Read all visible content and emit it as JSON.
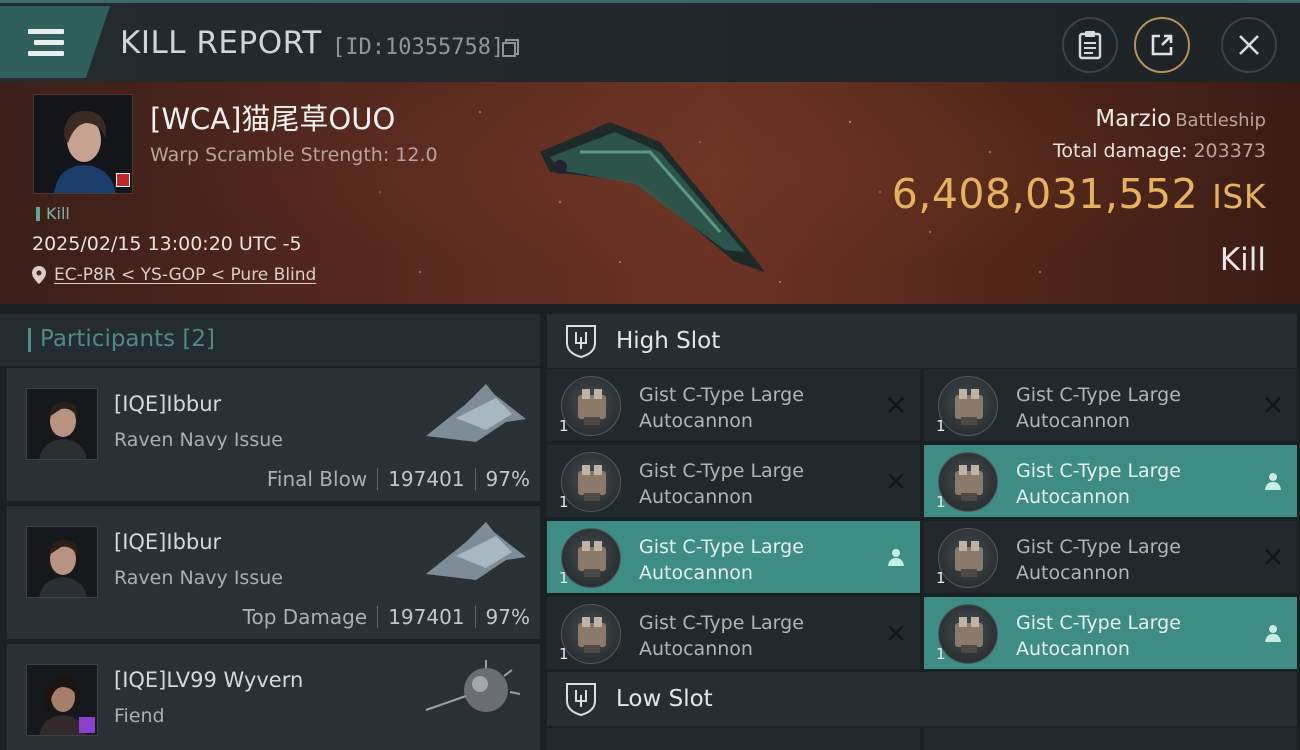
{
  "header": {
    "title": "KILL REPORT",
    "report_id": "[ID:10355758]"
  },
  "victim": {
    "name": "[WCA]猫尾草OUO",
    "scramble": "Warp Scramble Strength: 12.0",
    "kill_tag": "Kill",
    "timestamp": "2025/02/15 13:00:20 UTC -5",
    "location": "EC-P8R < YS-GOP < Pure Blind",
    "ship_name": "Marzio",
    "ship_class": "Battleship",
    "total_damage_label": "Total damage:",
    "total_damage": "203373",
    "isk_value": "6,408,031,552",
    "isk_unit": "ISK",
    "result": "Kill"
  },
  "participants": {
    "label": "Participants",
    "count": "[2]",
    "items": [
      {
        "name": "[IQE]Ibbur",
        "ship": "Raven Navy Issue",
        "stat_label": "Final Blow",
        "damage": "197401",
        "percent": "97%"
      },
      {
        "name": "[IQE]Ibbur",
        "ship": "Raven Navy Issue",
        "stat_label": "Top Damage",
        "damage": "197401",
        "percent": "97%"
      },
      {
        "name": "[IQE]LV99 Wyvern",
        "ship": "Fiend"
      }
    ]
  },
  "slots": {
    "high_label": "High Slot",
    "low_label": "Low Slot",
    "high_modules": [
      {
        "line1": "Gist C-Type Large",
        "line2": "Autocannon",
        "qty": "1",
        "state": "destroyed"
      },
      {
        "line1": "Gist C-Type Large",
        "line2": "Autocannon",
        "qty": "1",
        "state": "destroyed"
      },
      {
        "line1": "Gist C-Type Large",
        "line2": "Autocannon",
        "qty": "1",
        "state": "destroyed"
      },
      {
        "line1": "Gist C-Type Large",
        "line2": "Autocannon",
        "qty": "1",
        "state": "dropped"
      },
      {
        "line1": "Gist C-Type Large",
        "line2": "Autocannon",
        "qty": "1",
        "state": "dropped"
      },
      {
        "line1": "Gist C-Type Large",
        "line2": "Autocannon",
        "qty": "1",
        "state": "destroyed"
      },
      {
        "line1": "Gist C-Type Large",
        "line2": "Autocannon",
        "qty": "1",
        "state": "destroyed"
      },
      {
        "line1": "Gist C-Type Large",
        "line2": "Autocannon",
        "qty": "1",
        "state": "dropped"
      }
    ]
  },
  "colors": {
    "accent_teal": "#3d8d84",
    "isk_gold": "#e6b35b",
    "banner_red": "#5a2a20"
  }
}
